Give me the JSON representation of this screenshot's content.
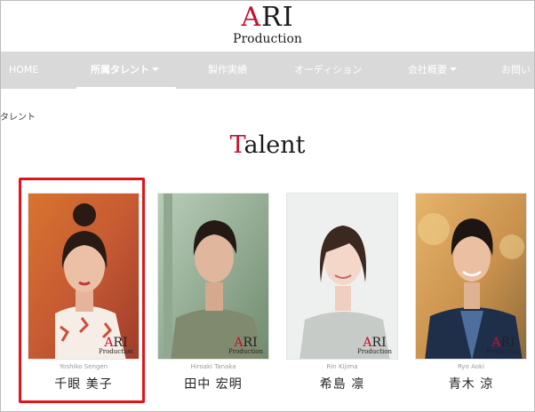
{
  "logo": {
    "top_accent": "A",
    "top_rest": "RI",
    "sub": "Production"
  },
  "nav": [
    {
      "label": "HOME",
      "active": false,
      "caret": false
    },
    {
      "label": "所属タレント",
      "active": true,
      "caret": true
    },
    {
      "label": "製作実績",
      "active": false,
      "caret": false
    },
    {
      "label": "オーディション",
      "active": false,
      "caret": false
    },
    {
      "label": "会社概要",
      "active": false,
      "caret": true
    },
    {
      "label": "お問い",
      "active": false,
      "caret": false
    }
  ],
  "breadcrumb": "タレント",
  "title": {
    "first": "T",
    "rest": "alent"
  },
  "card_logo": {
    "a": "A",
    "ri": "RI",
    "sub": "Production"
  },
  "talents": [
    {
      "romaji": "Yoshiko Sengen",
      "name": "千眼 美子"
    },
    {
      "romaji": "Hiroaki Tanaka",
      "name": "田中 宏明"
    },
    {
      "romaji": "Rin Kijima",
      "name": "希島 凛"
    },
    {
      "romaji": "Ryo Aoki",
      "name": "青木 涼"
    }
  ],
  "colors": {
    "accent": "#c8102e",
    "nav_bg": "#d9d9d9",
    "highlight": "#e0141a"
  }
}
